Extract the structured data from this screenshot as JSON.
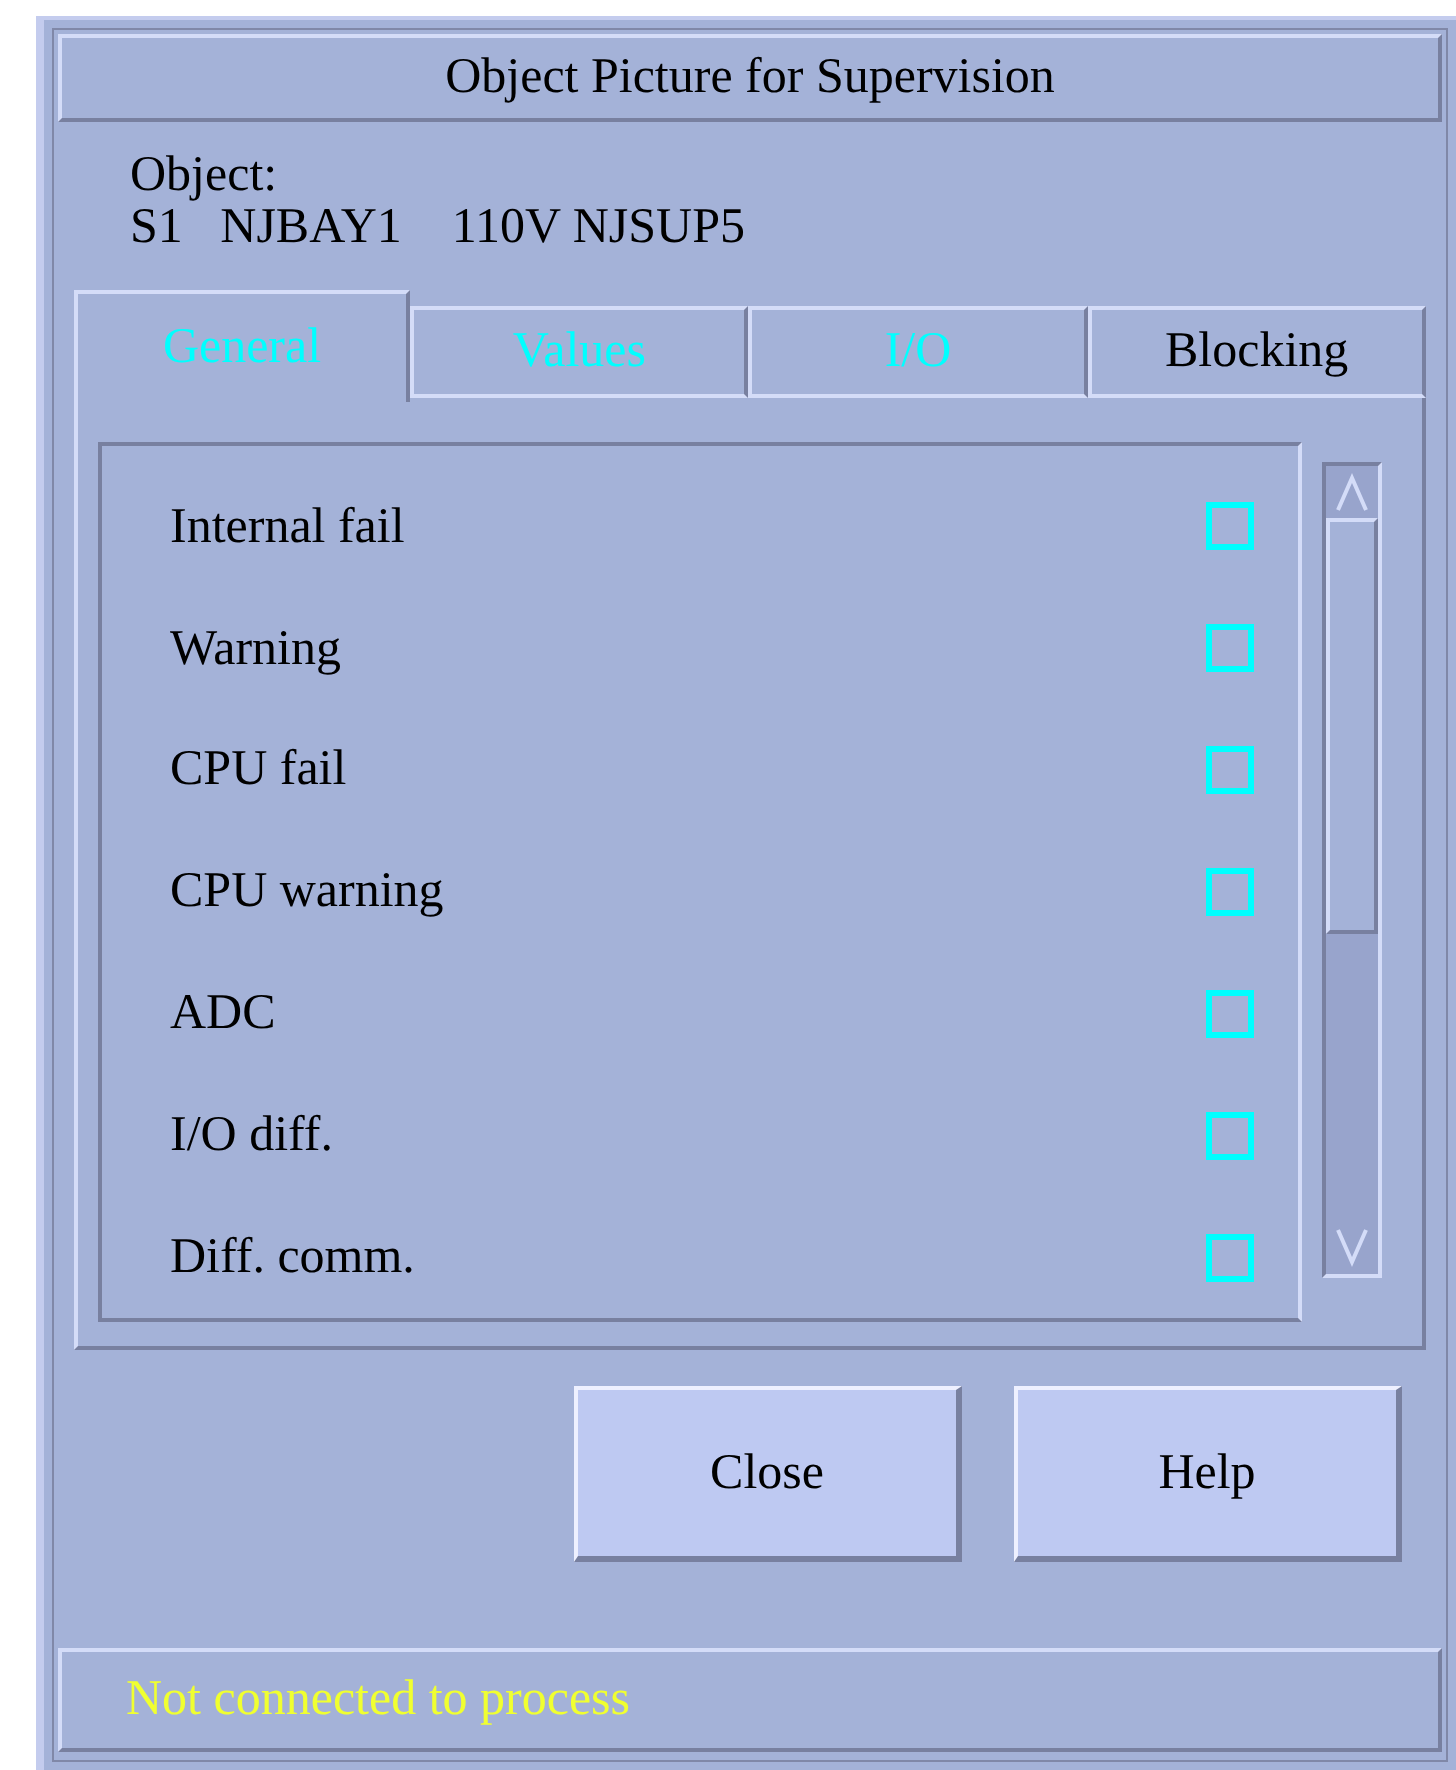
{
  "window": {
    "title": "Object Picture for Supervision"
  },
  "object": {
    "label": "Object:",
    "value": "S1   NJBAY1    110V NJSUP5"
  },
  "tabs": [
    {
      "label": "General",
      "selected": true,
      "color": "#00ffff"
    },
    {
      "label": "Values",
      "selected": false,
      "color": "#00ffff"
    },
    {
      "label": "I/O",
      "selected": false,
      "color": "#00ffff"
    },
    {
      "label": "Blocking",
      "selected": false,
      "color": "#000000"
    }
  ],
  "signals": [
    {
      "label": "Internal fail",
      "checked": false
    },
    {
      "label": "Warning",
      "checked": false
    },
    {
      "label": "CPU fail",
      "checked": false
    },
    {
      "label": "CPU warning",
      "checked": false
    },
    {
      "label": "ADC",
      "checked": false
    },
    {
      "label": "I/O diff.",
      "checked": false
    },
    {
      "label": "Diff. comm.",
      "checked": false
    }
  ],
  "buttons": [
    "Close",
    "Help"
  ],
  "status_bar": "Not connected to process"
}
